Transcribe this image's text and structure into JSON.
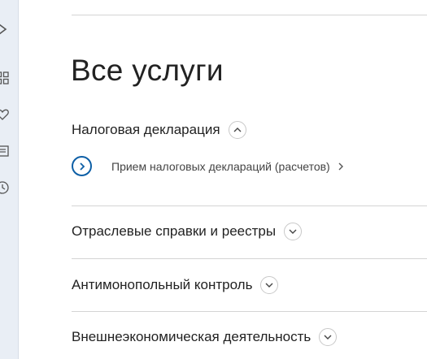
{
  "sidebar": {
    "icons": [
      "chevron-right-icon",
      "grid-icon",
      "heart-icon",
      "list-icon",
      "clock-icon"
    ]
  },
  "main": {
    "title": "Все услуги",
    "sections": [
      {
        "title": "Налоговая декларация",
        "expanded": true,
        "items": [
          {
            "label": "Прием налоговых деклараций (расчетов)"
          }
        ]
      },
      {
        "title": "Отраслевые справки и реестры",
        "expanded": false
      },
      {
        "title": "Антимонопольный контроль",
        "expanded": false
      },
      {
        "title": "Внешнеэкономическая деятельность",
        "expanded": false
      }
    ]
  },
  "colors": {
    "accent": "#0d5fa6",
    "sidebar_bg": "#e9eef5",
    "divider": "#d4d4d4"
  }
}
